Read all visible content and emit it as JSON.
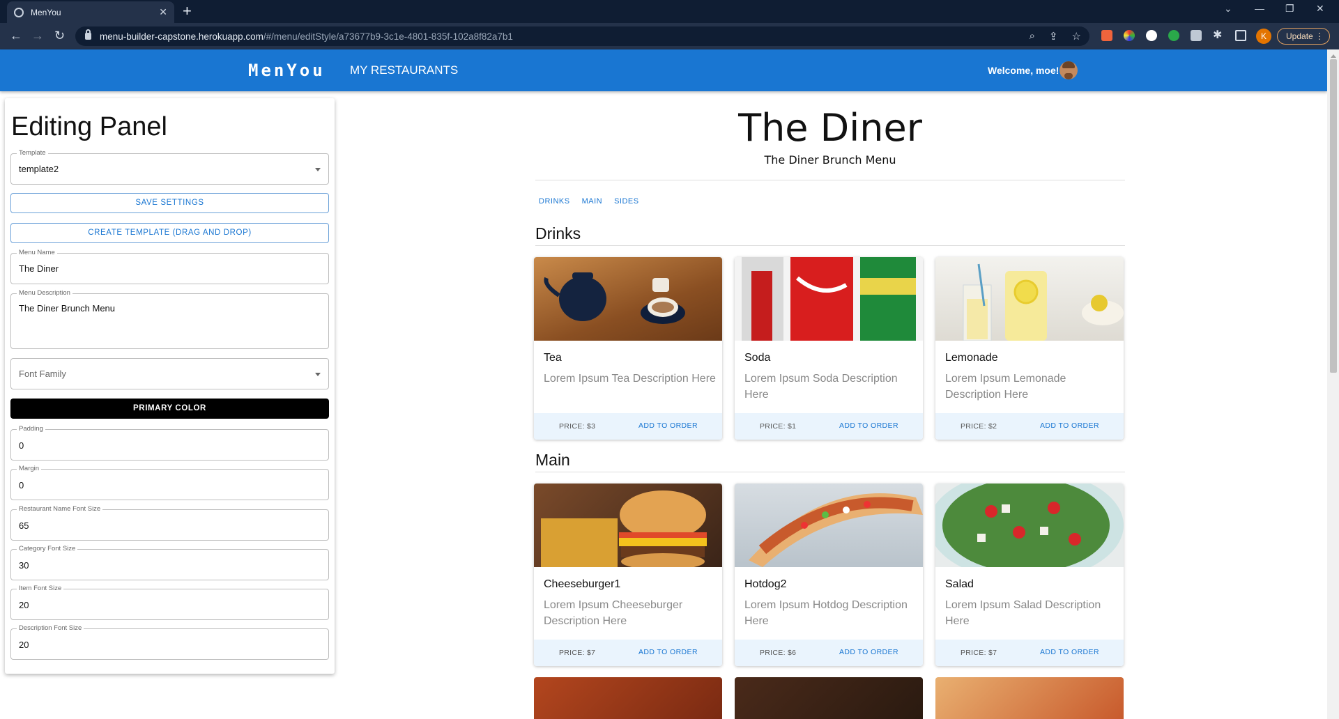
{
  "browser": {
    "tab_title": "MenYou",
    "url_host": "menu-builder-capstone.herokuapp.com",
    "url_path": "/#/menu/editStyle/a73677b9-3c1e-4801-835f-102a8f82a7b1",
    "profile_initial": "K",
    "update_label": "Update"
  },
  "appbar": {
    "brand": "MenYou",
    "nav_link": "MY RESTAURANTS",
    "welcome": "Welcome, moe!"
  },
  "panel": {
    "title": "Editing Panel",
    "template": {
      "label": "Template",
      "value": "template2"
    },
    "save_label": "SAVE SETTINGS",
    "create_template_label": "CREATE TEMPLATE (DRAG AND DROP)",
    "menu_name": {
      "label": "Menu Name",
      "value": "The Diner"
    },
    "menu_description": {
      "label": "Menu Description",
      "value": "The Diner Brunch Menu"
    },
    "font_family": {
      "placeholder": "Font Family"
    },
    "primary_color_label": "PRIMARY COLOR",
    "padding": {
      "label": "Padding",
      "value": "0"
    },
    "margin": {
      "label": "Margin",
      "value": "0"
    },
    "restaurant_name_font_size": {
      "label": "Restaurant Name Font Size",
      "value": "65"
    },
    "category_font_size": {
      "label": "Category Font Size",
      "value": "30"
    },
    "item_font_size": {
      "label": "Item Font Size",
      "value": "20"
    },
    "description_font_size": {
      "label": "Description Font Size",
      "value": "20"
    }
  },
  "menu": {
    "title": "The Diner",
    "description": "The Diner Brunch Menu",
    "category_tabs": [
      "DRINKS",
      "MAIN",
      "SIDES"
    ],
    "add_label": "ADD TO ORDER",
    "categories": [
      {
        "name": "Drinks",
        "items": [
          {
            "name": "Tea",
            "description": "Lorem Ipsum Tea Description Here",
            "price": "PRICE: $3"
          },
          {
            "name": "Soda",
            "description": "Lorem Ipsum Soda Description Here",
            "price": "PRICE: $1"
          },
          {
            "name": "Lemonade",
            "description": "Lorem Ipsum Lemonade Description Here",
            "price": "PRICE: $2"
          }
        ]
      },
      {
        "name": "Main",
        "items": [
          {
            "name": "Cheeseburger1",
            "description": "Lorem Ipsum Cheeseburger Description Here",
            "price": "PRICE: $7"
          },
          {
            "name": "Hotdog2",
            "description": "Lorem Ipsum Hotdog Description Here",
            "price": "PRICE: $6"
          },
          {
            "name": "Salad",
            "description": "Lorem Ipsum Salad Description Here",
            "price": "PRICE: $7"
          }
        ]
      }
    ]
  },
  "colors": {
    "appbar": "#1976d2",
    "primary_button": "#000000",
    "card_footer": "#eaf4fd",
    "accent_text": "#1976d2"
  }
}
